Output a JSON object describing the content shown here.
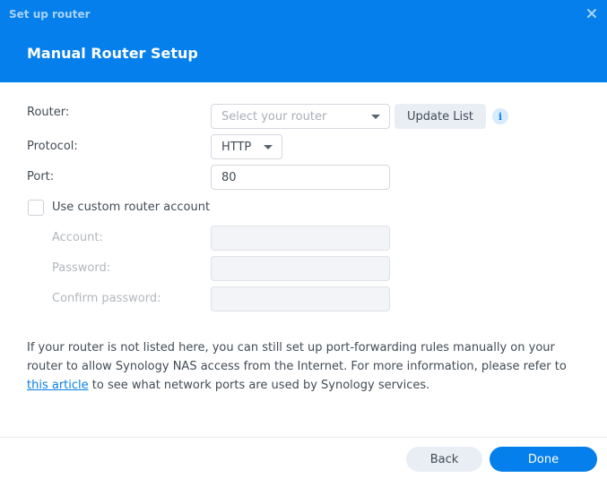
{
  "window": {
    "title": "Set up router",
    "close_icon": "close-icon"
  },
  "header": {
    "title": "Manual Router Setup"
  },
  "form": {
    "router": {
      "label": "Router:",
      "placeholder": "Select your router",
      "value": ""
    },
    "update_list_label": "Update List",
    "info_icon": "i",
    "protocol": {
      "label": "Protocol:",
      "value": "HTTP"
    },
    "port": {
      "label": "Port:",
      "value": "80"
    },
    "custom_account": {
      "label": "Use custom router account",
      "checked": false
    },
    "account": {
      "label": "Account:",
      "value": ""
    },
    "password": {
      "label": "Password:",
      "value": ""
    },
    "confirm_password": {
      "label": "Confirm password:",
      "value": ""
    }
  },
  "description": {
    "text_before": "If your router is not listed here, you can still set up port-forwarding rules manually on your router to allow Synology NAS access from the Internet. For more information, please refer to ",
    "link_text": "this article",
    "text_after": " to see what network ports are used by Synology services."
  },
  "footer": {
    "back_label": "Back",
    "done_label": "Done"
  },
  "colors": {
    "accent": "#057feb",
    "header_subtitle": "#a9d3fb",
    "secondary_button": "#e9eef5",
    "text": "#414b55"
  }
}
